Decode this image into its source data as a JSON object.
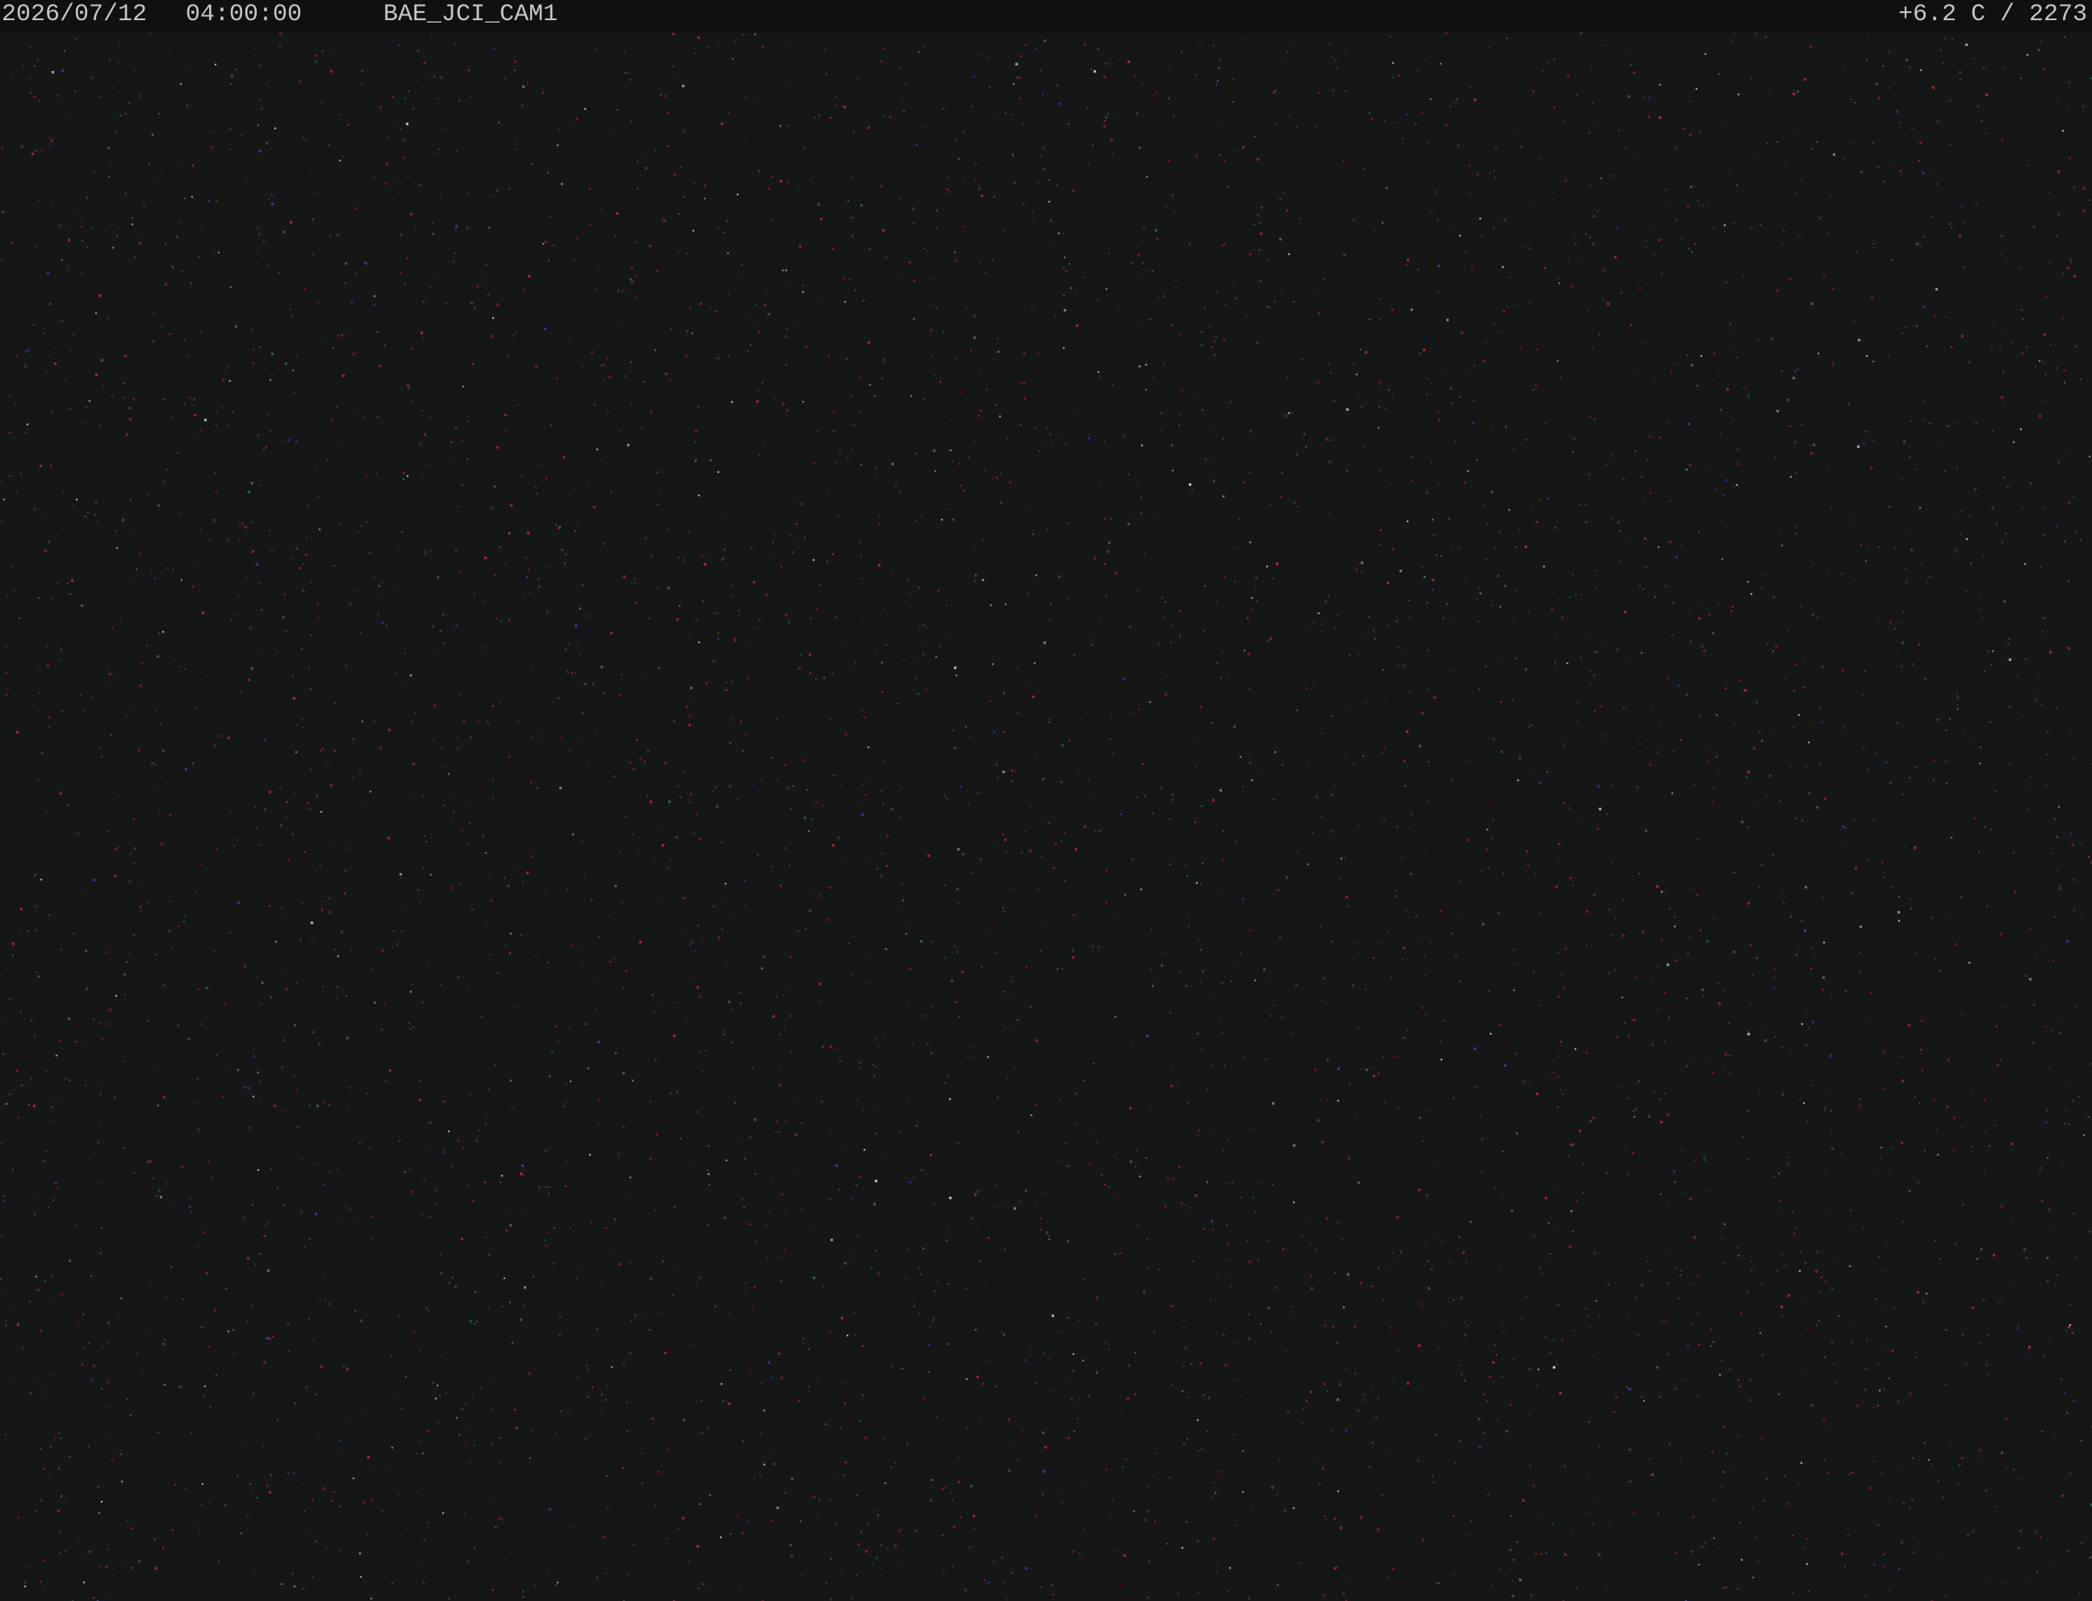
{
  "overlay": {
    "date": "2026/07/12",
    "time": "04:00:00",
    "camera_name": "BAE_JCI_CAM1",
    "sensor_readout": "+6.2 C / 2273"
  },
  "scene": {
    "description_colors": {
      "background": "#151617",
      "osd_bar": "#101010",
      "osd_text": "#c6c6c6",
      "noise_red": "#c0283a",
      "noise_green": "#3a6a46",
      "noise_blue": "#3848b0",
      "noise_white": "#d8d8d8"
    }
  }
}
